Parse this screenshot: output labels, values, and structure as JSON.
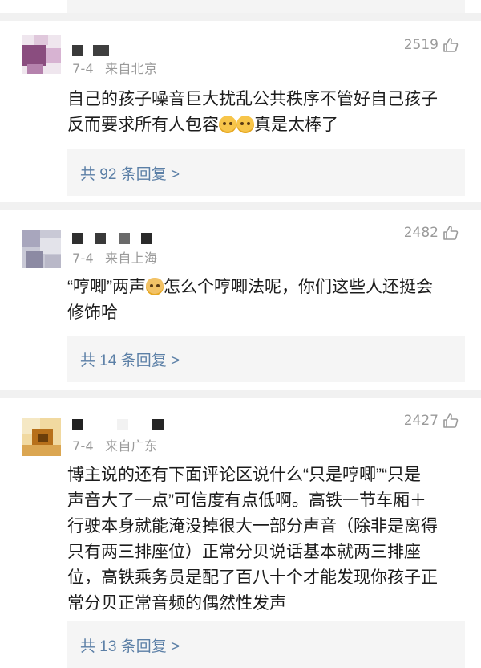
{
  "comments": [
    {
      "date": "7-4",
      "location": "来自北京",
      "likes": "2519",
      "text_line1": "自己的孩子噪音巨大扰乱公共秩序不管好自己孩子",
      "text_line2_a": "反而要求所有人包容",
      "text_line2_b": "真是太棒了",
      "replies": "共 92 条回复 >"
    },
    {
      "date": "7-4",
      "location": "来自上海",
      "likes": "2482",
      "text_line1_a": "“哼唧”两声",
      "text_line1_b": "怎么个哼唧法呢，你们这些人还挺会",
      "text_line2": "修饰哈",
      "replies": "共 14 条回复 >"
    },
    {
      "date": "7-4",
      "location": "来自广东",
      "likes": "2427",
      "lines": [
        "博主说的还有下面评论区说什么“只是哼唧”“只是",
        "声音大了一点”可信度有点低啊。高铁一节车厢＋",
        "行驶本身就能淹没掉很大一部分声音（除非是离得",
        "只有两三排座位）正常分贝说话基本就两三排座",
        "位，高铁乘务员是配了百八十个才能发现你孩子正",
        "常分贝正常音频的偶然性发声"
      ],
      "replies": "共 13 条回复 >"
    }
  ],
  "colors": {
    "meta": "#9a9a9a",
    "link": "#5b7fa6",
    "reply_bg": "#f5f5f5"
  },
  "icons": {
    "like": "thumbs-up-outline-icon",
    "emoji_1": "crying-laughing-emoji-icon",
    "emoji_2": "doge-emoji-icon"
  }
}
